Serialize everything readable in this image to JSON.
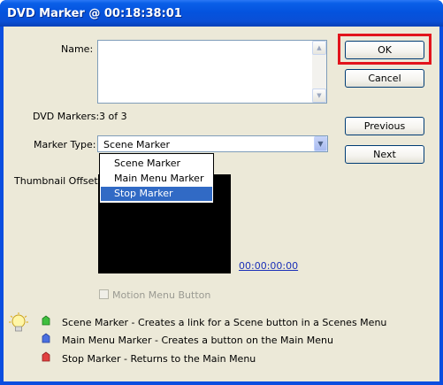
{
  "window": {
    "title": "DVD Marker @ 00:18:38:01"
  },
  "form": {
    "name_label": "Name:",
    "name_value": "",
    "dvd_markers_label": "DVD Markers:",
    "dvd_markers_value": "3 of 3",
    "marker_type_label": "Marker Type:",
    "marker_type_value": "Scene Marker",
    "thumbnail_offset_label": "Thumbnail Offset:",
    "thumbnail_timecode": "00:00:00:00",
    "motion_menu_label": "Motion Menu Button"
  },
  "dropdown": {
    "options": [
      "Scene Marker",
      "Main Menu Marker",
      "Stop Marker"
    ],
    "highlighted": "Stop Marker"
  },
  "buttons": {
    "ok": "OK",
    "cancel": "Cancel",
    "previous": "Previous",
    "next": "Next"
  },
  "legend": [
    {
      "text": "Scene Marker - Creates a link for a Scene button in a Scenes Menu",
      "icon": "green-marker-icon",
      "color": "#3fbf3f"
    },
    {
      "text": "Main Menu Marker - Creates a button on the Main Menu",
      "icon": "blue-marker-icon",
      "color": "#4a6fe0"
    },
    {
      "text": "Stop Marker - Returns to the Main Menu",
      "icon": "red-marker-icon",
      "color": "#e04040"
    }
  ],
  "colors": {
    "highlight": "#316ac5",
    "ok_annotation": "#e2141c",
    "timecode_link": "#1c31b8"
  }
}
